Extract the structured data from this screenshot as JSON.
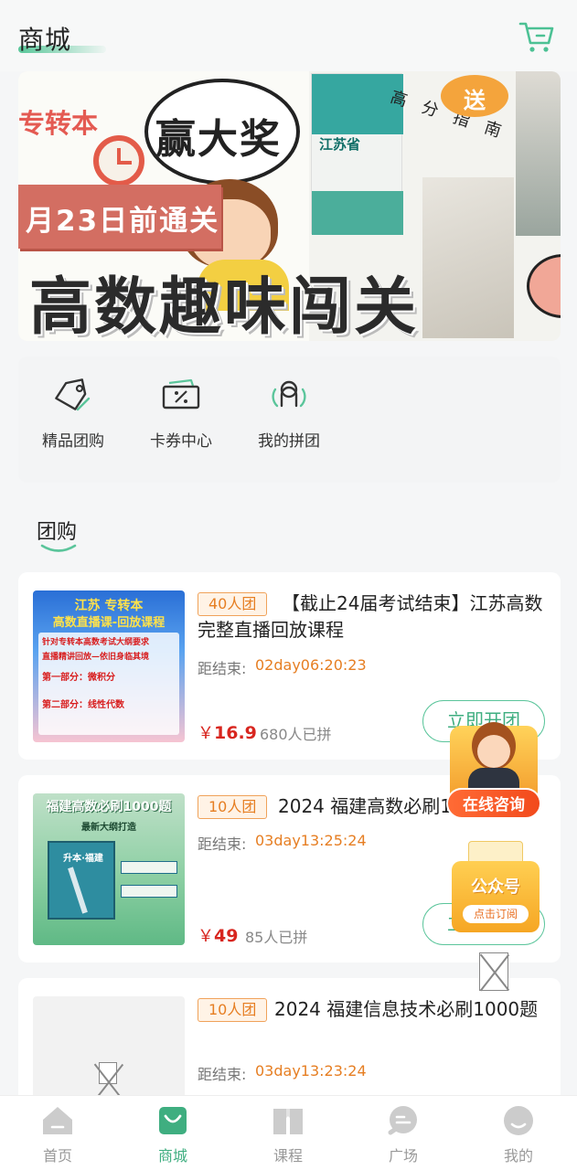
{
  "header": {
    "title": "商城",
    "cart_icon": "cart-icon"
  },
  "banner": {
    "corner_text": "专转本",
    "bubble_text": "赢大奖",
    "date_text": "月23日前通关",
    "main_text": "高数趣味闯关",
    "gift_text": "送",
    "guide_text": "高分指南",
    "book_title": "江苏省"
  },
  "quick_actions": [
    {
      "label": "精品团购",
      "icon": "tag-icon"
    },
    {
      "label": "卡券中心",
      "icon": "coupon-icon"
    },
    {
      "label": "我的拼团",
      "icon": "group-icon"
    }
  ],
  "section": {
    "title": "团购"
  },
  "products": [
    {
      "tag": "40人团",
      "title": "【截止24届考试结束】江苏高数完整直播回放课程",
      "countdown_label": "距结束:",
      "countdown": "02day06:20:23",
      "price_symbol": "￥",
      "price": "16.9",
      "sold": "680人已拼",
      "button": "立即开团",
      "thumb_title": "江苏 专转本",
      "thumb_sub": "高数直播课-回放课程",
      "thumb_lines": [
        "针对专转本高数考试大纲要求",
        "直播精讲回放—依旧身临其境",
        "第一部分：微积分",
        "第二部分：线性代数"
      ]
    },
    {
      "tag": "10人团",
      "title": "2024 福建高数必刷1000题",
      "countdown_label": "距结束:",
      "countdown": "03day13:25:24",
      "price_symbol": "￥",
      "price": "49",
      "sold": "85人已拼",
      "button": "立即开团",
      "thumb_title": "福建高数必刷1000题",
      "thumb_sub": "最新大纲打造",
      "thumb_book": "升本·福建"
    },
    {
      "tag": "10人团",
      "title": "2024 福建信息技术必刷1000题",
      "countdown_label": "距结束:",
      "countdown": "03day13:23:24"
    }
  ],
  "floating": {
    "consult_label": "在线咨询",
    "gzh_title": "公众号",
    "gzh_sub": "点击订阅"
  },
  "tabbar": [
    {
      "label": "首页",
      "icon": "home-icon",
      "active": false
    },
    {
      "label": "商城",
      "icon": "shop-bag-icon",
      "active": true
    },
    {
      "label": "课程",
      "icon": "book-icon",
      "active": false
    },
    {
      "label": "广场",
      "icon": "chat-icon",
      "active": false
    },
    {
      "label": "我的",
      "icon": "profile-icon",
      "active": false
    }
  ],
  "colors": {
    "accent": "#3fae80",
    "price": "#d8261f",
    "tag": "#e67e22"
  }
}
